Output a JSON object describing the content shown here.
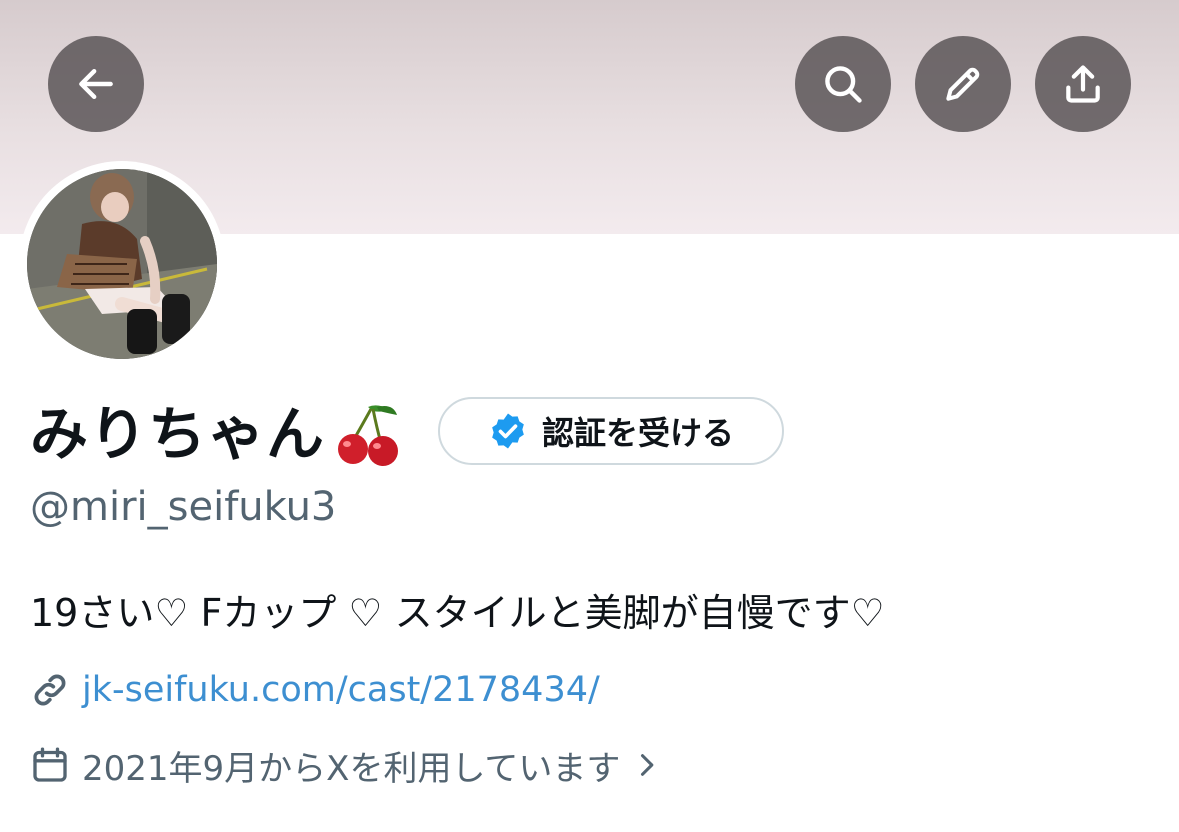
{
  "header": {
    "back_icon": "arrow-left-icon",
    "search_icon": "search-icon",
    "edit_icon": "pencil-icon",
    "share_icon": "share-upload-icon",
    "button_bg": "#5c5658"
  },
  "profile": {
    "display_name": "みりちゃん",
    "name_emoji": "cherry-emoji",
    "verify_button_label": "認証を受ける",
    "verify_icon": "verified-badge-icon",
    "verify_color": "#1d9bf0",
    "handle": "@miri_seifuku3",
    "bio": "19さい♡ Fカップ ♡ スタイルと美脚が自慢です♡",
    "link_icon": "link-icon",
    "link": "jk-seifuku.com/cast/2178434/",
    "joined_icon": "calendar-icon",
    "joined": "2021年9月からXを利用しています",
    "joined_chevron": "chevron-right-icon"
  }
}
